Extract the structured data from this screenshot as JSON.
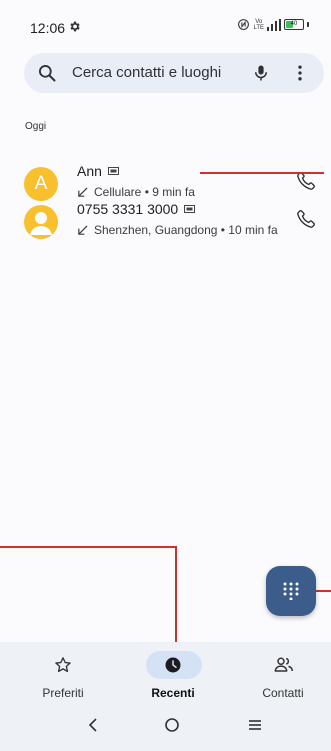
{
  "status": {
    "time": "12:06",
    "network_top": "Vo",
    "network_bottom": "LTE",
    "signal_label": "4G",
    "battery": "40"
  },
  "search": {
    "placeholder": "Cerca contatti e luoghi"
  },
  "section": {
    "label": "Oggi"
  },
  "calls": [
    {
      "avatar_letter": "A",
      "name": "Ann",
      "detail": "Cellulare • 9 min fa"
    },
    {
      "avatar_letter": "",
      "name": "0755 3331 3000",
      "detail": "Shenzhen, Guangdong • 10 min fa"
    }
  ],
  "nav": {
    "favorites": "Preferiti",
    "recents": "Recenti",
    "contacts": "Contatti"
  },
  "colors": {
    "accent": "#3c5c8c",
    "avatar": "#f8bf2e",
    "annotation": "#d32f2f"
  }
}
